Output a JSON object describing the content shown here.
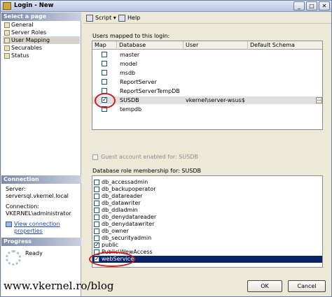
{
  "window": {
    "title": "Login - New",
    "controls": [
      "_",
      "□",
      "✕"
    ]
  },
  "sidebar": {
    "header": "Select a page",
    "pages": [
      {
        "label": "General",
        "selected": false
      },
      {
        "label": "Server Roles",
        "selected": false
      },
      {
        "label": "User Mapping",
        "selected": true
      },
      {
        "label": "Securables",
        "selected": false
      },
      {
        "label": "Status",
        "selected": false
      }
    ],
    "connection": {
      "header": "Connection",
      "server_label": "Server:",
      "server_value": "serversql.vkernel.local",
      "connection_label": "Connection:",
      "connection_value": "VKERNEL\\administrator",
      "link": "View connection properties"
    },
    "progress": {
      "header": "Progress",
      "status": "Ready"
    }
  },
  "toolbar": {
    "script_label": "Script",
    "script_dropdown": "▾",
    "help_label": "Help"
  },
  "users_mapped": {
    "label": "Users mapped to this login:",
    "columns": [
      "Map",
      "Database",
      "User",
      "Default Schema"
    ],
    "rows": [
      {
        "checked": false,
        "database": "master",
        "user": "",
        "schema": ""
      },
      {
        "checked": false,
        "database": "model",
        "user": "",
        "schema": ""
      },
      {
        "checked": false,
        "database": "msdb",
        "user": "",
        "schema": ""
      },
      {
        "checked": false,
        "database": "ReportServer",
        "user": "",
        "schema": ""
      },
      {
        "checked": false,
        "database": "ReportServerTempDB",
        "user": "",
        "schema": ""
      },
      {
        "checked": true,
        "database": "SUSDB",
        "user": "vkernel\\server-wsus$",
        "schema": "",
        "selected": true
      },
      {
        "checked": false,
        "database": "tempdb",
        "user": "",
        "schema": ""
      }
    ],
    "ellipsis": "..."
  },
  "guest": {
    "label": "Guest account enabled for: SUSDB",
    "checked": false,
    "enabled": false
  },
  "roles": {
    "label": "Database role membership for: SUSDB",
    "items": [
      {
        "label": "db_accessadmin",
        "checked": false
      },
      {
        "label": "db_backupoperator",
        "checked": false
      },
      {
        "label": "db_datareader",
        "checked": false
      },
      {
        "label": "db_datawriter",
        "checked": false
      },
      {
        "label": "db_ddladmin",
        "checked": false
      },
      {
        "label": "db_denydatareader",
        "checked": false
      },
      {
        "label": "db_denydatawriter",
        "checked": false
      },
      {
        "label": "db_owner",
        "checked": false
      },
      {
        "label": "db_securityadmin",
        "checked": false
      },
      {
        "label": "public",
        "checked": true
      },
      {
        "label": "Public\\WewAccess",
        "checked": false
      },
      {
        "label": "webService",
        "checked": true,
        "selected": true
      }
    ]
  },
  "buttons": {
    "ok": "OK",
    "cancel": "Cancel"
  },
  "watermark": "www.vkernel.ro/blog",
  "colors": {
    "selection": "#0a246a",
    "highlight_circle": "#d31a1a",
    "link": "#1d47b1",
    "panel_bg": "#ece9d8"
  },
  "icons": [
    "login-window-icon",
    "page-icon",
    "script-icon",
    "help-icon",
    "connection-properties-icon",
    "progress-spinner-icon"
  ]
}
